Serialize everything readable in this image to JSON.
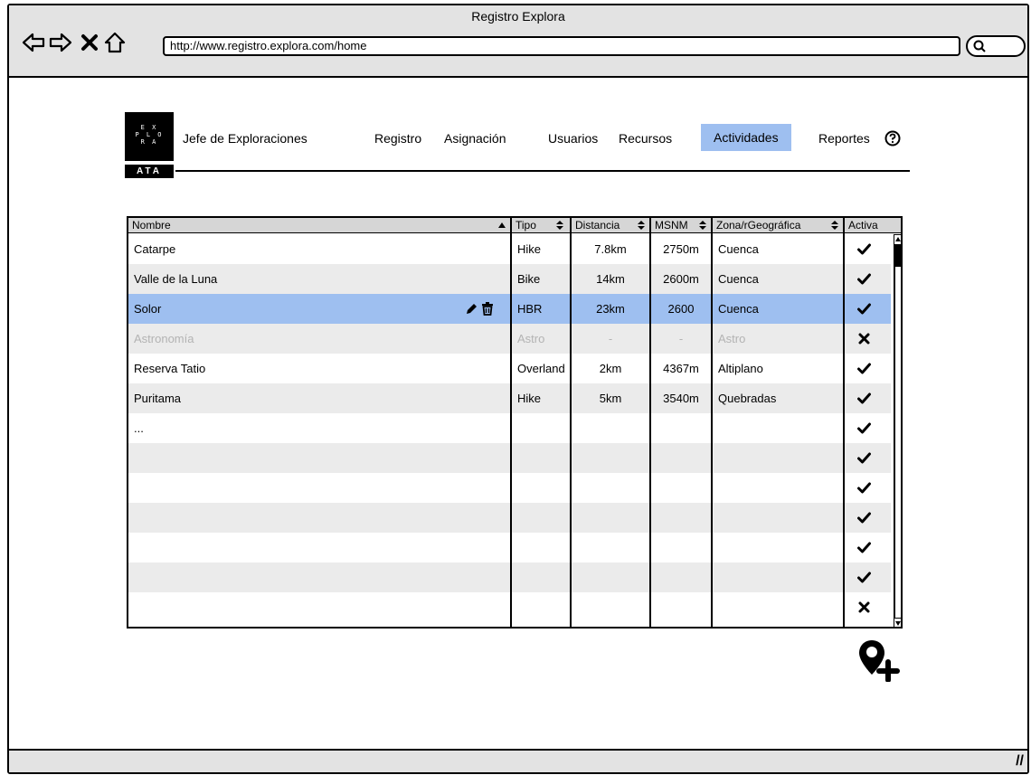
{
  "window": {
    "title": "Registro Explora"
  },
  "browser": {
    "url": "http://www.registro.explora.com/home",
    "back_icon": "arrow-left-icon",
    "forward_icon": "arrow-right-icon",
    "stop_icon": "close-icon",
    "home_icon": "home-icon",
    "search_icon": "search-icon"
  },
  "brand": {
    "logo_lines": [
      "E X",
      "P L O",
      "R A"
    ],
    "logo_ata": "ATA",
    "role": "Jefe de Exploraciones"
  },
  "menu": {
    "items": [
      {
        "label": "Registro"
      },
      {
        "label": "Asignación"
      },
      {
        "label": "Usuarios"
      },
      {
        "label": "Recursos"
      },
      {
        "label": "Actividades",
        "active": true
      },
      {
        "label": "Reportes"
      }
    ],
    "help_icon": "help-icon",
    "active_color": "#9ebff0"
  },
  "table": {
    "columns": [
      "Nombre",
      "Tipo",
      "Distancia",
      "MSNM",
      "Zona/rGeográfica",
      "Activa"
    ],
    "rows": [
      {
        "nombre": "Catarpe",
        "tipo": "Hike",
        "distancia": "7.8km",
        "msnm": "2750m",
        "zona": "Cuenca",
        "activa": true
      },
      {
        "nombre": "Valle de la Luna",
        "tipo": "Bike",
        "distancia": "14km",
        "msnm": "2600m",
        "zona": "Cuenca",
        "activa": true
      },
      {
        "nombre": "Solor",
        "tipo": "HBR",
        "distancia": "23km",
        "msnm": "2600",
        "zona": "Cuenca",
        "activa": true,
        "selected": true
      },
      {
        "nombre": "Astronomía",
        "tipo": "Astro",
        "distancia": "-",
        "msnm": "-",
        "zona": "Astro",
        "activa": false,
        "disabled": true
      },
      {
        "nombre": "Reserva Tatio",
        "tipo": "Overland",
        "distancia": "2km",
        "msnm": "4367m",
        "zona": "Altiplano",
        "activa": true
      },
      {
        "nombre": "Puritama",
        "tipo": "Hike",
        "distancia": "5km",
        "msnm": "3540m",
        "zona": "Quebradas",
        "activa": true
      },
      {
        "nombre": "...",
        "tipo": "",
        "distancia": "",
        "msnm": "",
        "zona": "",
        "activa": true
      },
      {
        "nombre": "",
        "tipo": "",
        "distancia": "",
        "msnm": "",
        "zona": "",
        "activa": true
      },
      {
        "nombre": "",
        "tipo": "",
        "distancia": "",
        "msnm": "",
        "zona": "",
        "activa": true
      },
      {
        "nombre": "",
        "tipo": "",
        "distancia": "",
        "msnm": "",
        "zona": "",
        "activa": true
      },
      {
        "nombre": "",
        "tipo": "",
        "distancia": "",
        "msnm": "",
        "zona": "",
        "activa": true
      },
      {
        "nombre": "",
        "tipo": "",
        "distancia": "",
        "msnm": "",
        "zona": "",
        "activa": true
      },
      {
        "nombre": "",
        "tipo": "",
        "distancia": "",
        "msnm": "",
        "zona": "",
        "activa": false
      }
    ],
    "row_tools_icons": [
      "pencil-icon",
      "trash-icon"
    ],
    "selected_color": "#9ebff0"
  },
  "actions": {
    "add_poi_icon": "map-marker-plus-icon"
  }
}
